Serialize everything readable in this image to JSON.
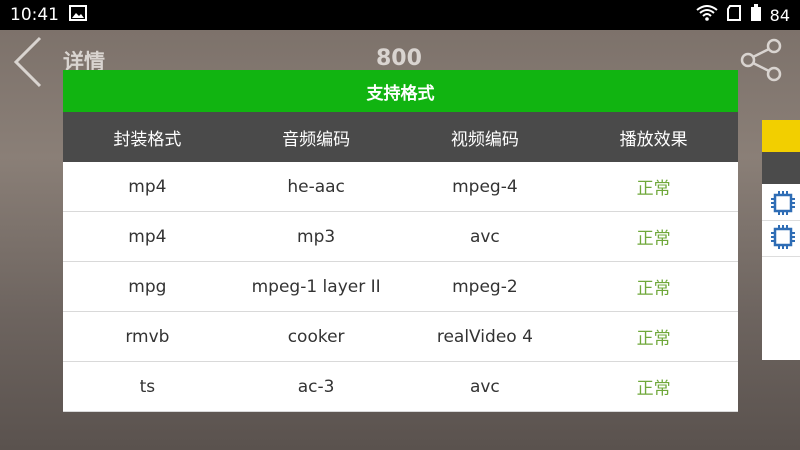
{
  "status_bar": {
    "time": "10:41",
    "battery": "84",
    "icons": [
      "image-icon",
      "wifi-icon",
      "sim-icon",
      "battery-icon"
    ]
  },
  "app_header": {
    "back_icon": "back-chevron-icon",
    "title": "详情",
    "center_title": "800",
    "share_icon": "share-icon"
  },
  "dialog": {
    "title": "支持格式",
    "columns": [
      "封装格式",
      "音频编码",
      "视频编码",
      "播放效果"
    ],
    "rows": [
      {
        "container": "mp4",
        "audio": "he-aac",
        "video": "mpeg-4",
        "result": "正常"
      },
      {
        "container": "mp4",
        "audio": "mp3",
        "video": "avc",
        "result": "正常"
      },
      {
        "container": "mpg",
        "audio": "mpeg-1 layer II",
        "video": "mpeg-2",
        "result": "正常"
      },
      {
        "container": "rmvb",
        "audio": "cooker",
        "video": "realVideo 4",
        "result": "正常"
      },
      {
        "container": "ts",
        "audio": "ac-3",
        "video": "avc",
        "result": "正常"
      }
    ],
    "colors": {
      "header": "#11b411",
      "column_header": "#4a4a4a",
      "status_text": "#6fa83a"
    }
  },
  "side_panel": {
    "colors": {
      "accent": "#f2cf00",
      "header": "#4b4b4b",
      "chip": "#2f6db5"
    },
    "icons": [
      "chip-icon",
      "chip-icon"
    ]
  }
}
